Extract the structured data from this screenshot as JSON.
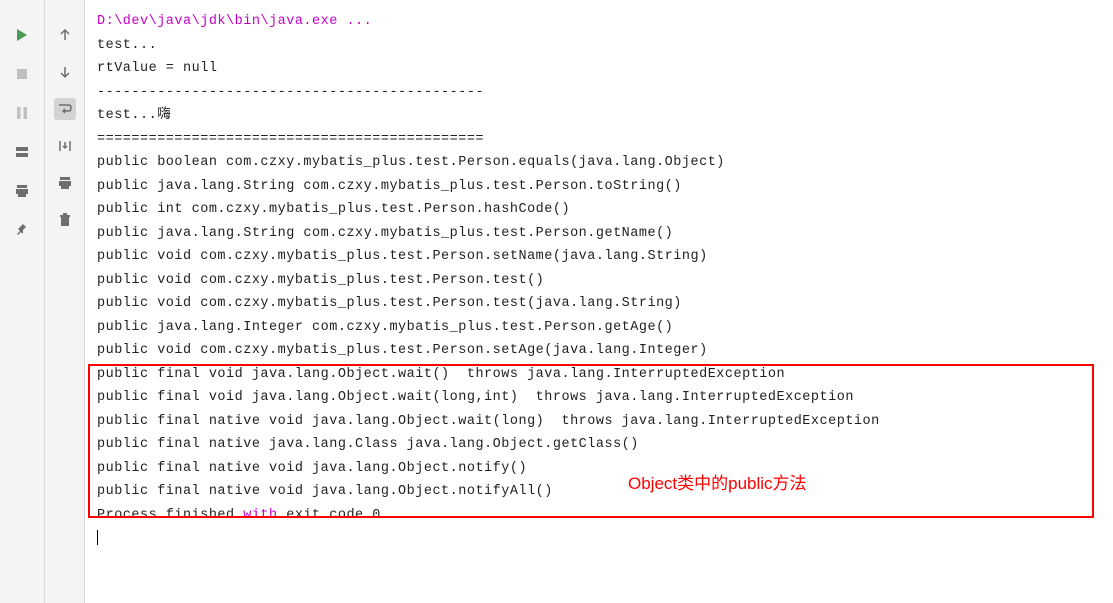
{
  "toolbar_left": {
    "run": "run",
    "stop": "stop",
    "pause": "pause",
    "layout": "layout",
    "print": "print",
    "pin": "pin"
  },
  "toolbar_right": {
    "up": "up",
    "down": "down",
    "wrap": "soft-wrap",
    "scroll": "scroll-to-end",
    "trash": "delete"
  },
  "console": {
    "cmd": "D:\\dev\\java\\jdk\\bin\\java.exe ...",
    "lines": [
      "test...",
      "rtValue = null",
      "---------------------------------------------",
      "test...嗨",
      "=============================================",
      "public boolean com.czxy.mybatis_plus.test.Person.equals(java.lang.Object)",
      "public java.lang.String com.czxy.mybatis_plus.test.Person.toString()",
      "public int com.czxy.mybatis_plus.test.Person.hashCode()",
      "public java.lang.String com.czxy.mybatis_plus.test.Person.getName()",
      "public void com.czxy.mybatis_plus.test.Person.setName(java.lang.String)",
      "public void com.czxy.mybatis_plus.test.Person.test()",
      "public void com.czxy.mybatis_plus.test.Person.test(java.lang.String)",
      "public java.lang.Integer com.czxy.mybatis_plus.test.Person.getAge()",
      "public void com.czxy.mybatis_plus.test.Person.setAge(java.lang.Integer)",
      "public final void java.lang.Object.wait()  throws java.lang.InterruptedException",
      "public final void java.lang.Object.wait(long,int)  throws java.lang.InterruptedException",
      "public final native void java.lang.Object.wait(long)  throws java.lang.InterruptedException",
      "public final native java.lang.Class java.lang.Object.getClass()",
      "public final native void java.lang.Object.notify()",
      "public final native void java.lang.Object.notifyAll()"
    ],
    "blank": "",
    "finish_prefix": "Process finished ",
    "finish_kw": "with",
    "finish_suffix": " exit code 0"
  },
  "annotation": "Object类中的public方法"
}
